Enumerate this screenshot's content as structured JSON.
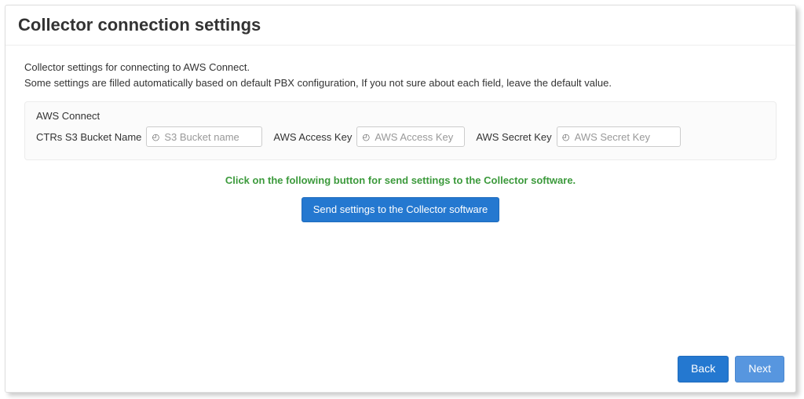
{
  "header": {
    "title": "Collector connection settings"
  },
  "intro": {
    "line1": "Collector settings for connecting to AWS Connect.",
    "line2": "Some settings are filled automatically based on default PBX configuration, If you not sure about each field, leave the default value."
  },
  "section": {
    "title": "AWS Connect",
    "fields": {
      "bucket": {
        "label": "CTRs S3 Bucket Name",
        "placeholder": "S3 Bucket name",
        "value": ""
      },
      "access_key": {
        "label": "AWS Access Key",
        "placeholder": "AWS Access Key",
        "value": ""
      },
      "secret_key": {
        "label": "AWS Secret Key",
        "placeholder": "AWS Secret Key",
        "value": ""
      }
    }
  },
  "hint": "Click on the following button for send settings to the Collector software.",
  "buttons": {
    "send": "Send settings to the Collector software",
    "back": "Back",
    "next": "Next"
  },
  "icons": {
    "info_glyph": "◴"
  }
}
